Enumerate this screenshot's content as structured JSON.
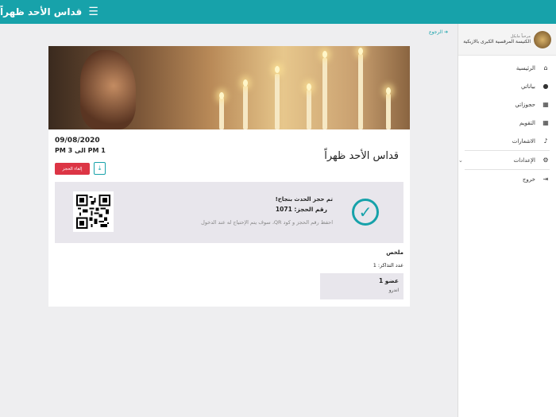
{
  "topbar": {
    "title": "قداس الأحد ظهراً",
    "menu_icon": "hamburger-icon"
  },
  "sidebar": {
    "greeting": "مرحباً مايكل",
    "church": "الكنيسة المرقسية الكبرى بالازبكية",
    "items": [
      {
        "label": "الرئيسية",
        "icon": "home-icon",
        "glyph": "⌂"
      },
      {
        "label": "بياناتي",
        "icon": "user-icon",
        "glyph": "●"
      },
      {
        "label": "حجوزاتي",
        "icon": "calendar-icon",
        "glyph": "▦"
      },
      {
        "label": "التقويم",
        "icon": "calendar-icon",
        "glyph": "▦"
      },
      {
        "label": "الاشعارات",
        "icon": "bell-icon",
        "glyph": "🔔"
      },
      {
        "label": "الإعدادات",
        "icon": "gear-icon",
        "glyph": "⚙"
      },
      {
        "label": "خروج",
        "icon": "sign-out-icon",
        "glyph": "⇥"
      }
    ]
  },
  "back": "الرجوع",
  "event": {
    "title": "قداس الأحد ظهراً",
    "date": "09/08/2020",
    "time": "1 PM الى 3 PM",
    "cancel_label": "إلغاء الحجز"
  },
  "confirmation": {
    "message": "تم حجز الحدث بنجاح!",
    "booking_number": "رقم الحجز: 1071",
    "note": "احفظ رقم الحجز و كود QR، سوف يتم الإحتياج له عند الدخول"
  },
  "summary": {
    "heading": "ملخص",
    "tickets": "عدد التذاكر: 1",
    "members": [
      {
        "name": "عضو 1",
        "value": "اندرو"
      }
    ]
  },
  "colors": {
    "accent": "#17a2aa",
    "danger": "#dc3545"
  }
}
